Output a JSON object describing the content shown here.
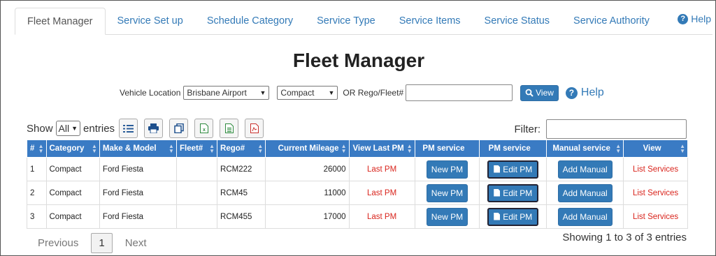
{
  "tabs": [
    "Fleet Manager",
    "Service Set up",
    "Schedule Category",
    "Service Type",
    "Service Items",
    "Service Status",
    "Service Authority"
  ],
  "help_label": "Help",
  "page_title": "Fleet Manager",
  "search": {
    "location_label": "Vehicle Location",
    "location_value": "Brisbane Airport",
    "category_value": "Compact",
    "rego_label": "OR Rego/Fleet#",
    "rego_value": "",
    "view_button": "View",
    "help_label": "Help"
  },
  "toolbar": {
    "show_label": "Show",
    "length_value": "All",
    "entries_label": "entries",
    "filter_label": "Filter:",
    "filter_value": ""
  },
  "table": {
    "headers": [
      "#",
      "Category",
      "Make & Model",
      "Fleet#",
      "Rego#",
      "Current Mileage",
      "View Last PM",
      "PM service",
      "PM service",
      "Manual service",
      "View"
    ],
    "rows": [
      {
        "num": "1",
        "category": "Compact",
        "model": "Ford Fiesta",
        "fleet": "",
        "rego": "RCM222",
        "mileage": "26000",
        "last_pm": "Last PM",
        "new_pm": "New PM",
        "edit_pm": "Edit PM",
        "manual": "Add Manual",
        "view": "List Services"
      },
      {
        "num": "2",
        "category": "Compact",
        "model": "Ford Fiesta",
        "fleet": "",
        "rego": "RCM45",
        "mileage": "11000",
        "last_pm": "Last PM",
        "new_pm": "New PM",
        "edit_pm": "Edit PM",
        "manual": "Add Manual",
        "view": "List Services"
      },
      {
        "num": "3",
        "category": "Compact",
        "model": "Ford Fiesta",
        "fleet": "",
        "rego": "RCM455",
        "mileage": "17000",
        "last_pm": "Last PM",
        "new_pm": "New PM",
        "edit_pm": "Edit PM",
        "manual": "Add Manual",
        "view": "List Services"
      }
    ]
  },
  "pagination": {
    "previous": "Previous",
    "current": "1",
    "next": "Next",
    "info": "Showing 1 to 3 of 3 entries"
  }
}
